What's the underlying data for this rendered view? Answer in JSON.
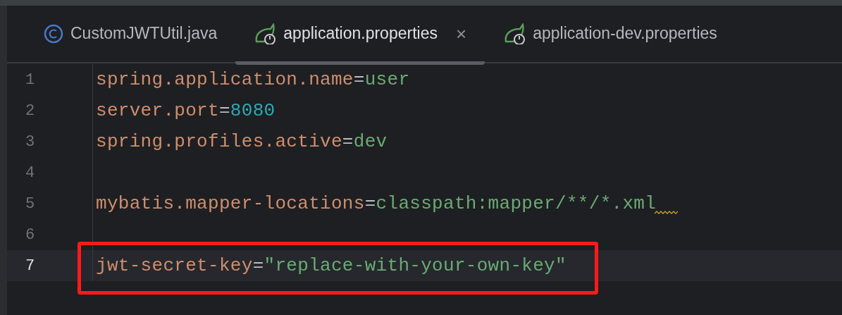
{
  "tabs": [
    {
      "kind": "java",
      "label": "CustomJWTUtil.java",
      "selected": false
    },
    {
      "kind": "properties",
      "label": "application.properties",
      "selected": true,
      "close": "×"
    },
    {
      "kind": "properties",
      "label": "application-dev.properties",
      "selected": false
    }
  ],
  "editor": {
    "lines": [
      {
        "number": "1",
        "current": false,
        "warning": false,
        "annotated": false,
        "tokens": [
          {
            "kind": "key",
            "text": "spring.application.name"
          },
          {
            "kind": "sep",
            "text": "="
          },
          {
            "kind": "value",
            "text": "user"
          }
        ]
      },
      {
        "number": "2",
        "current": false,
        "warning": false,
        "annotated": false,
        "tokens": [
          {
            "kind": "key",
            "text": "server.port"
          },
          {
            "kind": "sep",
            "text": "="
          },
          {
            "kind": "number",
            "text": "8080"
          }
        ]
      },
      {
        "number": "3",
        "current": false,
        "warning": false,
        "annotated": false,
        "tokens": [
          {
            "kind": "key",
            "text": "spring.profiles.active"
          },
          {
            "kind": "sep",
            "text": "="
          },
          {
            "kind": "value",
            "text": "dev"
          }
        ]
      },
      {
        "number": "4",
        "current": false,
        "warning": false,
        "annotated": false
      },
      {
        "number": "5",
        "current": false,
        "warning": true,
        "annotated": false,
        "tokens": [
          {
            "kind": "key",
            "text": "mybatis.mapper-locations"
          },
          {
            "kind": "sep",
            "text": "="
          },
          {
            "kind": "value",
            "text": "classpath:mapper/**/*.xml"
          }
        ]
      },
      {
        "number": "6",
        "current": false,
        "warning": false,
        "annotated": false
      },
      {
        "number": "7",
        "current": true,
        "warning": false,
        "annotated": true,
        "tokens": [
          {
            "kind": "key",
            "text": "jwt-secret-key"
          },
          {
            "kind": "sep",
            "text": "="
          },
          {
            "kind": "value",
            "text": "\"replace-with-your-own-key\""
          }
        ]
      }
    ]
  }
}
